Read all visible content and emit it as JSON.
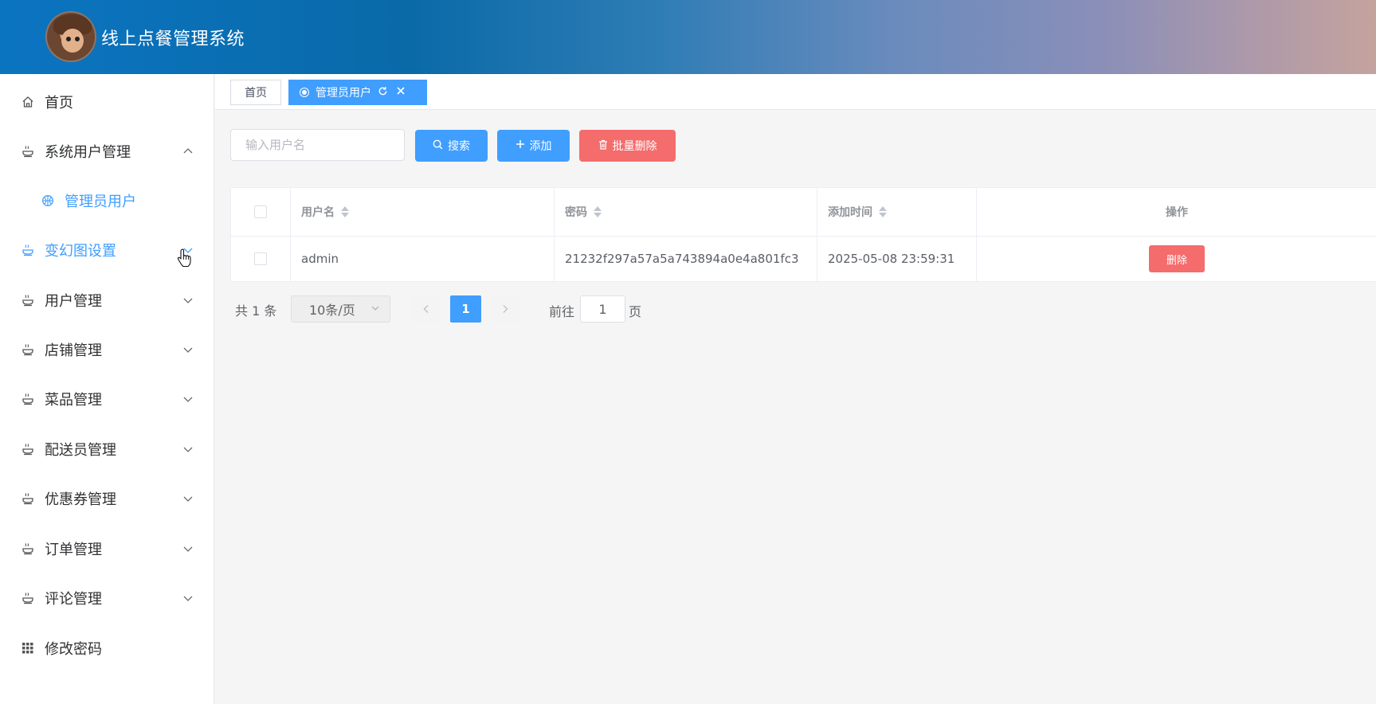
{
  "header": {
    "title": "线上点餐管理系统"
  },
  "sidebar": {
    "items": [
      {
        "label": "首页",
        "icon": "home-icon"
      },
      {
        "label": "系统用户管理",
        "icon": "bowl-icon",
        "expanded": true
      },
      {
        "label": "管理员用户",
        "icon": "basketball-icon",
        "sub": true,
        "active": true
      },
      {
        "label": "变幻图设置",
        "icon": "bowl-icon",
        "hover": true
      },
      {
        "label": "用户管理",
        "icon": "bowl-icon"
      },
      {
        "label": "店铺管理",
        "icon": "bowl-icon"
      },
      {
        "label": "菜品管理",
        "icon": "bowl-icon"
      },
      {
        "label": "配送员管理",
        "icon": "bowl-icon"
      },
      {
        "label": "优惠券管理",
        "icon": "bowl-icon"
      },
      {
        "label": "订单管理",
        "icon": "bowl-icon"
      },
      {
        "label": "评论管理",
        "icon": "bowl-icon"
      },
      {
        "label": "修改密码",
        "icon": "grid-icon"
      }
    ]
  },
  "tabs": {
    "home": "首页",
    "active": "管理员用户"
  },
  "toolbar": {
    "search_placeholder": "输入用户名",
    "search_label": "搜索",
    "add_label": "添加",
    "batch_delete_label": "批量删除"
  },
  "table": {
    "columns": [
      "用户名",
      "密码",
      "添加时间",
      "操作"
    ],
    "rows": [
      {
        "username": "admin",
        "password": "21232f297a57a5a743894a0e4a801fc3",
        "added_at": "2025-05-08 23:59:31",
        "action": "删除"
      }
    ]
  },
  "pagination": {
    "total": "共 1 条",
    "page_size": "10条/页",
    "current_page": "1",
    "goto_label": "前往",
    "goto_value": "1",
    "goto_suffix": "页"
  },
  "colors": {
    "primary": "#409eff",
    "danger": "#f56c6c",
    "header_gradient_start": "#0b74c1",
    "header_gradient_end": "#c4a39e"
  }
}
